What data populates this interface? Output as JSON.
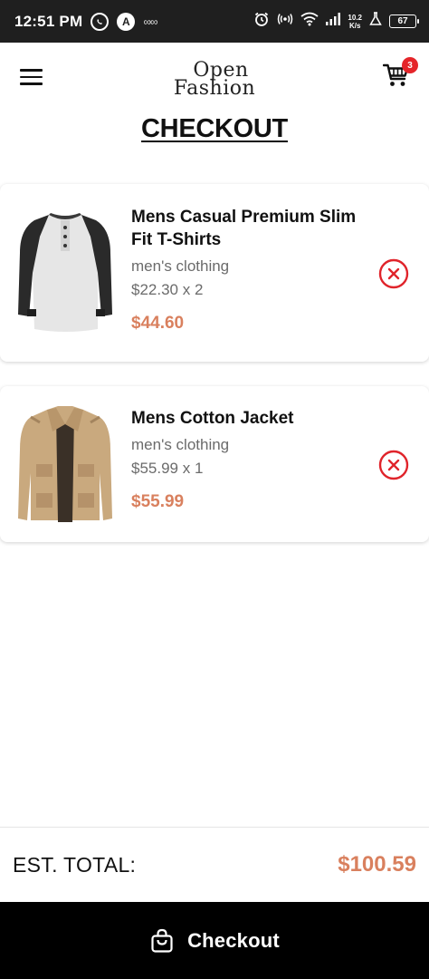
{
  "status_bar": {
    "time": "12:51 PM",
    "app_badge": "A",
    "infinity_glyph": "∞∞",
    "speed_top": "10.2",
    "speed_bottom": "K/s",
    "battery": "67"
  },
  "header": {
    "logo_line1": "Open",
    "logo_line2": "Fashion",
    "cart_count": "3"
  },
  "page_title": "CHECKOUT",
  "items": [
    {
      "name": "Mens Casual Premium Slim Fit T-Shirts",
      "category": "men's clothing",
      "quantity_text": "$22.30 x 2",
      "line_total": "$44.60"
    },
    {
      "name": "Mens Cotton Jacket",
      "category": "men's clothing",
      "quantity_text": "$55.99 x 1",
      "line_total": "$55.99"
    }
  ],
  "summary": {
    "total_label": "EST. TOTAL:",
    "total_value": "$100.59"
  },
  "checkout_button": {
    "label": "Checkout"
  },
  "colors": {
    "accent": "#d9805e",
    "remove": "#e0242b",
    "badge": "#e5252a",
    "button_bg": "#000000"
  },
  "icons": {
    "menu": "hamburger-icon",
    "cart": "cart-icon",
    "remove": "close-circle-icon",
    "checkout": "shopping-bag-icon"
  }
}
